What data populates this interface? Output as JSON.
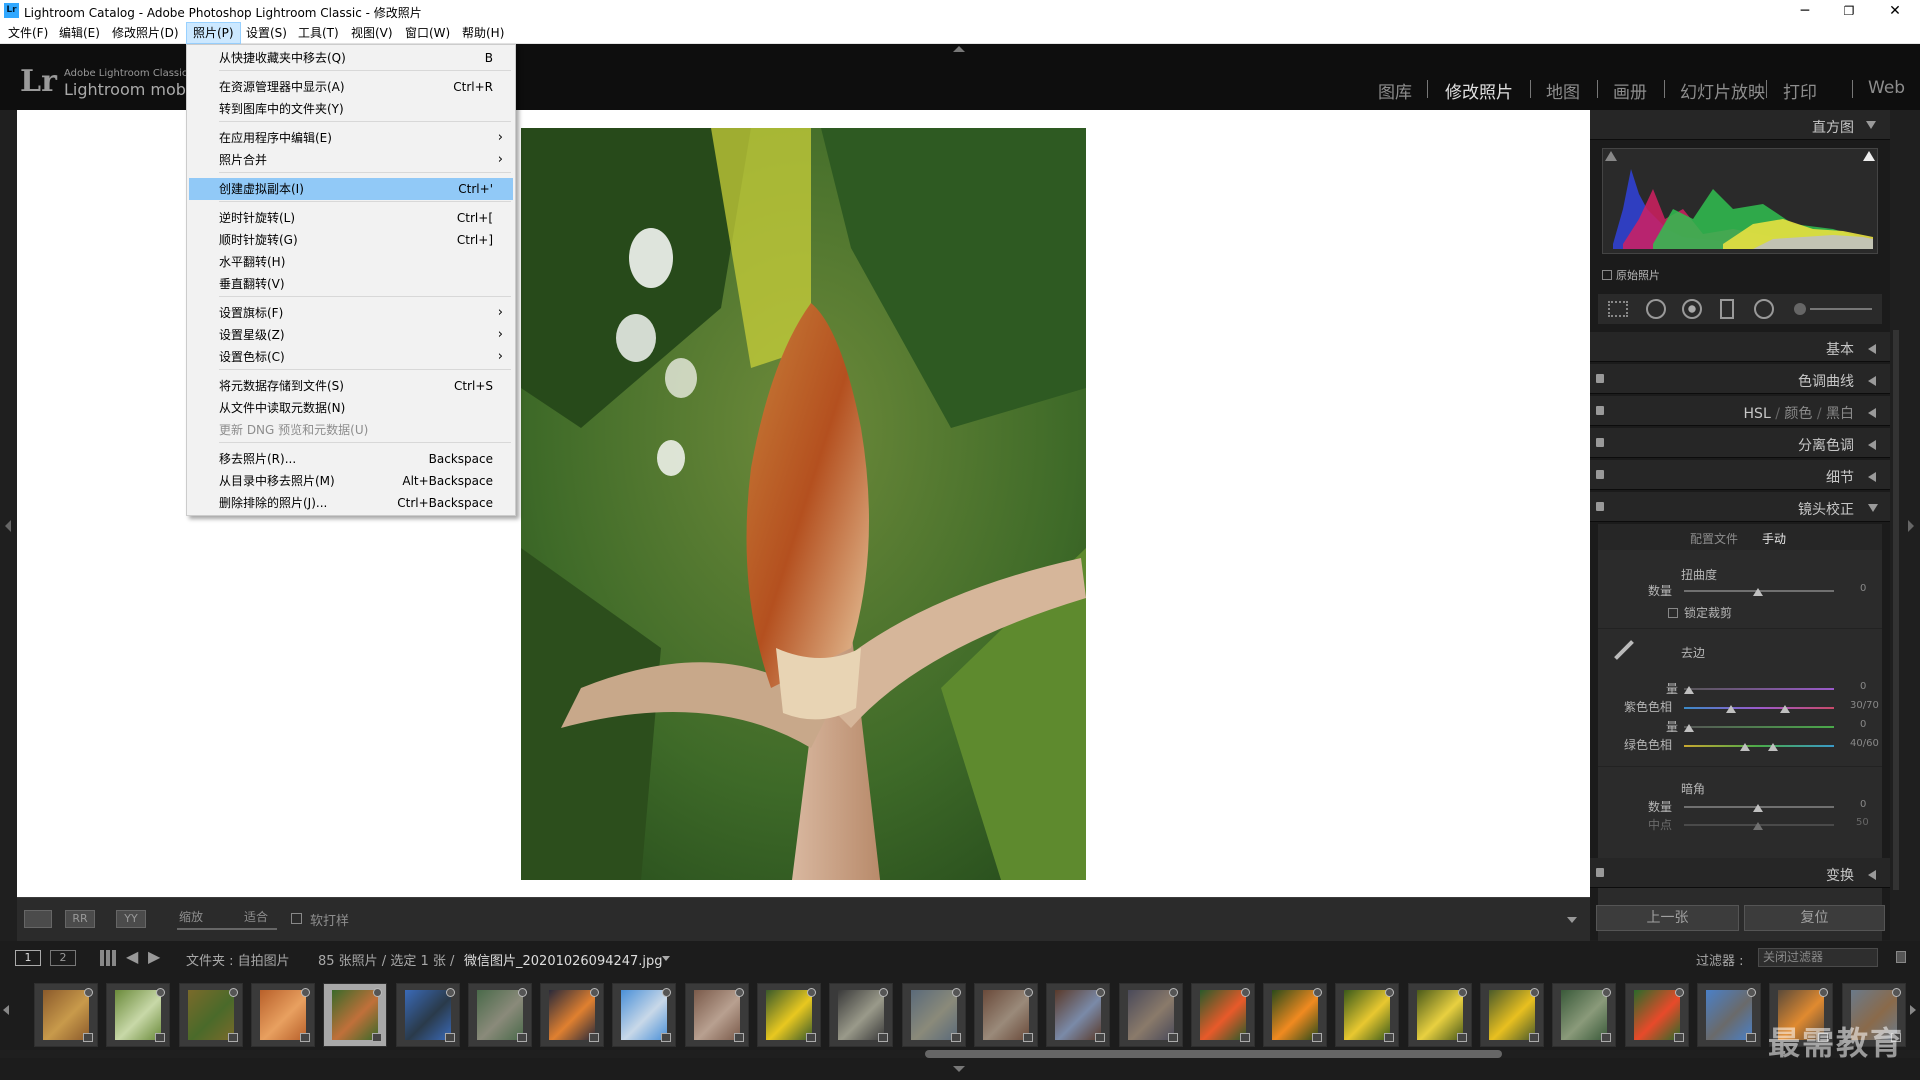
{
  "window": {
    "title": "Lightroom Catalog - Adobe Photoshop Lightroom Classic - 修改照片",
    "app_icon": "Lr",
    "controls": [
      "minimize",
      "maximize",
      "close"
    ]
  },
  "menubar": [
    {
      "label": "文件(F)"
    },
    {
      "label": "编辑(E)"
    },
    {
      "label": "修改照片(D)"
    },
    {
      "label": "照片(P)",
      "active": true
    },
    {
      "label": "设置(S)"
    },
    {
      "label": "工具(T)"
    },
    {
      "label": "视图(V)"
    },
    {
      "label": "窗口(W)"
    },
    {
      "label": "帮助(H)"
    }
  ],
  "identity": {
    "logo": "Lr",
    "brand_line1": "Adobe Lightroom Classic",
    "brand_line2": "Lightroom mobi"
  },
  "modules": [
    {
      "label": "图库"
    },
    {
      "label": "修改照片",
      "active": true
    },
    {
      "label": "地图"
    },
    {
      "label": "画册"
    },
    {
      "label": "幻灯片放映"
    },
    {
      "label": "打印"
    },
    {
      "label": "Web"
    }
  ],
  "photo_menu": {
    "items": [
      {
        "label": "从快捷收藏夹中移去(Q)",
        "shortcut": "B"
      },
      {
        "sep": true
      },
      {
        "label": "在资源管理器中显示(A)",
        "shortcut": "Ctrl+R"
      },
      {
        "label": "转到图库中的文件夹(Y)",
        "shortcut": ""
      },
      {
        "sep": true
      },
      {
        "label": "在应用程序中编辑(E)",
        "submenu": true
      },
      {
        "label": "照片合并",
        "submenu": true
      },
      {
        "sep": true
      },
      {
        "label": "创建虚拟副本(I)",
        "shortcut": "Ctrl+'",
        "highlighted": true
      },
      {
        "sep": true
      },
      {
        "label": "逆时针旋转(L)",
        "shortcut": "Ctrl+["
      },
      {
        "label": "顺时针旋转(G)",
        "shortcut": "Ctrl+]"
      },
      {
        "label": "水平翻转(H)",
        "shortcut": ""
      },
      {
        "label": "垂直翻转(V)",
        "shortcut": ""
      },
      {
        "sep": true
      },
      {
        "label": "设置旗标(F)",
        "submenu": true
      },
      {
        "label": "设置星级(Z)",
        "submenu": true
      },
      {
        "label": "设置色标(C)",
        "submenu": true
      },
      {
        "sep": true
      },
      {
        "label": "将元数据存储到文件(S)",
        "shortcut": "Ctrl+S"
      },
      {
        "label": "从文件中读取元数据(N)",
        "shortcut": ""
      },
      {
        "label": "更新 DNG 预览和元数据(U)",
        "shortcut": "",
        "disabled": true
      },
      {
        "sep": true
      },
      {
        "label": "移去照片(R)...",
        "shortcut": "Backspace"
      },
      {
        "label": "从目录中移去照片(M)",
        "shortcut": "Alt+Backspace"
      },
      {
        "label": "删除排除的照片(J)...",
        "shortcut": "Ctrl+Backspace"
      }
    ]
  },
  "toolbar": {
    "zoom_label": "缩放",
    "fit_label": "适合",
    "soft_proof_label": "软打样",
    "view_loupe": "loupe-view-icon",
    "view_rr": "RR",
    "view_yy": "YY"
  },
  "right_panel": {
    "histogram_title": "直方图",
    "original_photo_label": "原始照片",
    "basic": "基本",
    "tone_curve": "色调曲线",
    "hsl_tabs": [
      "HSL",
      "颜色",
      "黑白"
    ],
    "split_toning": "分离色调",
    "detail": "细节",
    "lens_corrections": "镜头校正",
    "lens_tabs": [
      "配置文件",
      "手动"
    ],
    "distortion_heading": "扭曲度",
    "amount_label": "数量",
    "amount_value": "0",
    "constrain_crop": "锁定裁剪",
    "defringe_heading": "去边",
    "purple_amount_label": "量",
    "purple_amount_value": "0",
    "purple_hue_label": "紫色色相",
    "purple_hue_value": "30/70",
    "green_amount_label": "量",
    "green_amount_value": "0",
    "green_hue_label": "绿色色相",
    "green_hue_value": "40/60",
    "vignetting_heading": "暗角",
    "vig_amount_label": "数量",
    "vig_amount_value": "0",
    "vig_mid_label": "中点",
    "vig_mid_value": "50",
    "transform": "变换",
    "prev_button": "上一张",
    "reset_button": "复位"
  },
  "filmstrip": {
    "source_label": "文件夹 : 自拍图片",
    "count_label": "85 张照片 / 选定 1 张 /",
    "filename": "微信图片_20201026094247.jpg",
    "filter_label": "过滤器 :",
    "filter_value": "关闭过滤器",
    "page1": "1",
    "page2": "2",
    "selected_index": 4,
    "thumbs": [
      {
        "c1": "#8b5a2b",
        "c2": "#c89a4b"
      },
      {
        "c1": "#6a8a3a",
        "c2": "#c8d8a8"
      },
      {
        "c1": "#7a6a2a",
        "c2": "#4a6a2a"
      },
      {
        "c1": "#b8602a",
        "c2": "#e8a060"
      },
      {
        "c1": "#3a6a2a",
        "c2": "#c0703a"
      },
      {
        "c1": "#3a6ab8",
        "c2": "#2a3a4a"
      },
      {
        "c1": "#4a6a4a",
        "c2": "#8a8a7a"
      },
      {
        "c1": "#2a2a3a",
        "c2": "#e08030"
      },
      {
        "c1": "#4a90d8",
        "c2": "#c8d8e8"
      },
      {
        "c1": "#7a5a4a",
        "c2": "#b8a090"
      },
      {
        "c1": "#3a5a2a",
        "c2": "#e8c820"
      },
      {
        "c1": "#3a3a3a",
        "c2": "#9a9a8a"
      },
      {
        "c1": "#5a6a7a",
        "c2": "#8a8a7a"
      },
      {
        "c1": "#6a4a3a",
        "c2": "#9a8a7a"
      },
      {
        "c1": "#5a3a2a",
        "c2": "#7a8aa8"
      },
      {
        "c1": "#4a4a5a",
        "c2": "#8a7a6a"
      },
      {
        "c1": "#2a5a2a",
        "c2": "#e85a2a"
      },
      {
        "c1": "#2a4a1a",
        "c2": "#f08a20"
      },
      {
        "c1": "#3a5a1a",
        "c2": "#e8c830"
      },
      {
        "c1": "#4a5a1a",
        "c2": "#e8d040"
      },
      {
        "c1": "#4a5a2a",
        "c2": "#e8c020"
      },
      {
        "c1": "#3a5a3a",
        "c2": "#8a9a7a"
      },
      {
        "c1": "#2a6a2a",
        "c2": "#e84a2a"
      },
      {
        "c1": "#4a80c8",
        "c2": "#6a6a6a"
      },
      {
        "c1": "#5a4a3a",
        "c2": "#e08a30"
      },
      {
        "c1": "#6a7a8a",
        "c2": "#8a6a4a"
      }
    ]
  },
  "watermark": "最需教育"
}
